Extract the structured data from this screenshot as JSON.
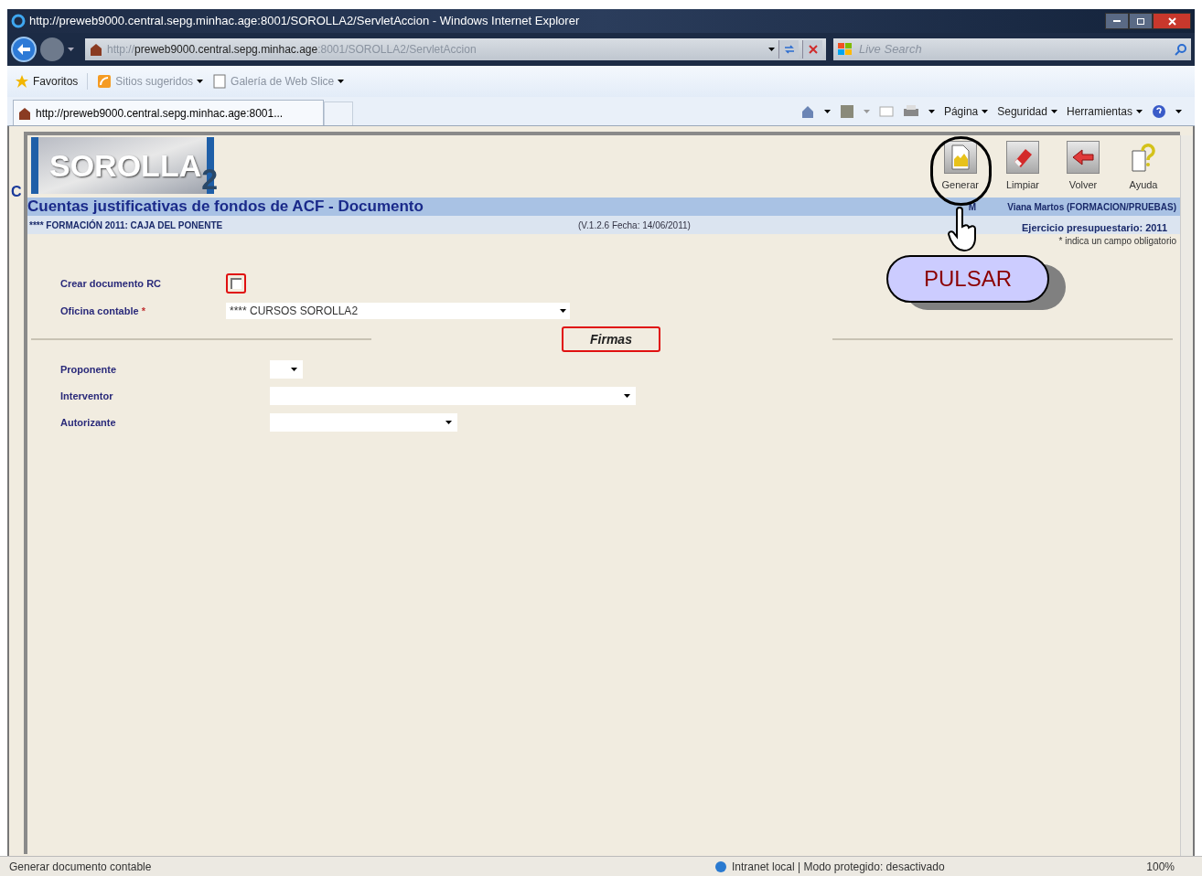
{
  "window": {
    "title": "http://preweb9000.central.sepg.minhac.age:8001/SOROLLA2/ServletAccion - Windows Internet Explorer"
  },
  "address_bar": {
    "url_parts": [
      {
        "text": "http://",
        "dim": true
      },
      {
        "text": "preweb9000.central.sepg.minhac.age",
        "dim": false
      },
      {
        "text": ":8001/SOROLLA2/ServletAccion",
        "dim": true
      }
    ]
  },
  "search": {
    "placeholder": "Live Search"
  },
  "favorites_bar": {
    "items": [
      {
        "label": "Favoritos",
        "kind": "favorites"
      },
      {
        "label": "Sitios sugeridos",
        "kind": "suggested"
      },
      {
        "label": "Galería de Web Slice",
        "kind": "slice"
      }
    ]
  },
  "tabs": [
    {
      "label": "http://preweb9000.central.sepg.minhac.age:8001...",
      "selected": true
    }
  ],
  "command_bar": [
    {
      "label": "Página"
    },
    {
      "label": "Seguridad"
    },
    {
      "label": "Herramientas"
    }
  ],
  "background_fragment": "C",
  "app": {
    "logo": {
      "text": "SOROLLA",
      "suffix": "2"
    },
    "toolbar": [
      {
        "label": "Generar",
        "kind": "generate"
      },
      {
        "label": "Limpiar",
        "kind": "clear"
      },
      {
        "label": "Volver",
        "kind": "back"
      },
      {
        "label": "Ayuda",
        "kind": "help"
      }
    ],
    "heading": "Cuentas justificativas de fondos de ACF - Documento",
    "user": {
      "prefix": "M",
      "name": "Viana Martos (FORMACION/PRUEBAS)"
    },
    "subheading": "**** FORMACIÓN 2011: CAJA DEL PONENTE",
    "version": "(V.1.2.6 Fecha: 14/06/2011)",
    "fiscal_year": "Ejercicio presupuestario: 2011",
    "required_note": "* indica un campo obligatorio",
    "fields": [
      {
        "label": "Crear documento RC",
        "kind": "checkbox",
        "checked": false,
        "highlighted": true
      },
      {
        "label": "Oficina contable",
        "required_mark": "*",
        "kind": "select",
        "value": "**** CURSOS SOROLLA2"
      }
    ],
    "section": {
      "title": "Firmas",
      "highlighted": true
    },
    "signatures": [
      {
        "label": "Proponente",
        "kind": "short"
      },
      {
        "label": "Interventor",
        "kind": "long"
      },
      {
        "label": "Autorizante",
        "kind": "medium"
      }
    ]
  },
  "callout": {
    "text": "PULSAR"
  },
  "status_bar": {
    "text": "Generar documento contable",
    "zone": "Intranet local | Modo protegido: desactivado",
    "zoom": "100%"
  }
}
